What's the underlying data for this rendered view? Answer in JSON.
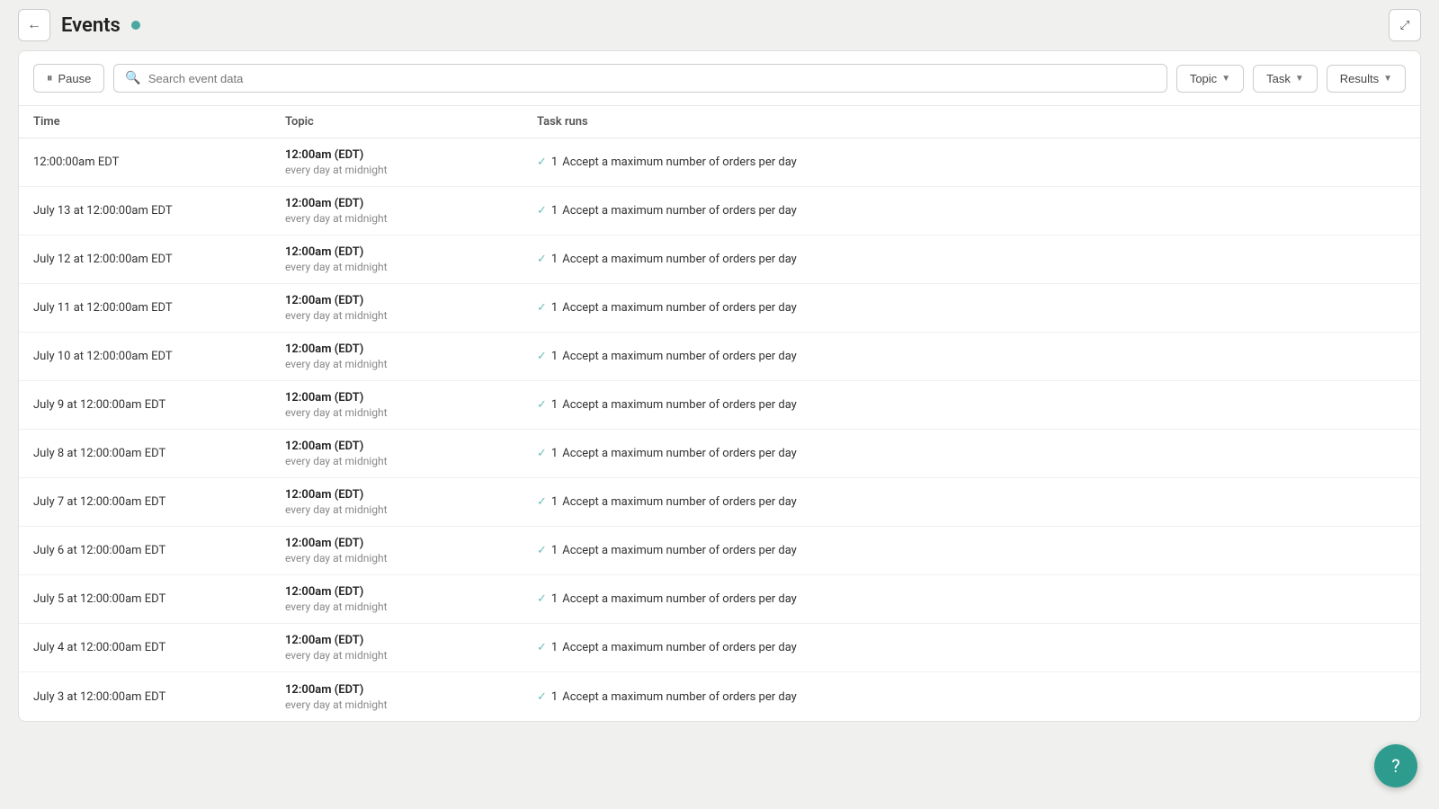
{
  "header": {
    "back_label": "←",
    "title": "Events",
    "expand_label": "⤢"
  },
  "toolbar": {
    "pause_label": "Pause",
    "search_placeholder": "Search event data",
    "topic_label": "Topic",
    "task_label": "Task",
    "results_label": "Results"
  },
  "table": {
    "columns": [
      "Time",
      "Topic",
      "Task runs"
    ],
    "rows": [
      {
        "time": "12:00:00am EDT",
        "topic_time": "12:00am (EDT)",
        "topic_sub": "every day at midnight",
        "task_count": "1",
        "task_label": "Accept a maximum number of orders per day"
      },
      {
        "time": "July 13 at 12:00:00am EDT",
        "topic_time": "12:00am (EDT)",
        "topic_sub": "every day at midnight",
        "task_count": "1",
        "task_label": "Accept a maximum number of orders per day"
      },
      {
        "time": "July 12 at 12:00:00am EDT",
        "topic_time": "12:00am (EDT)",
        "topic_sub": "every day at midnight",
        "task_count": "1",
        "task_label": "Accept a maximum number of orders per day"
      },
      {
        "time": "July 11 at 12:00:00am EDT",
        "topic_time": "12:00am (EDT)",
        "topic_sub": "every day at midnight",
        "task_count": "1",
        "task_label": "Accept a maximum number of orders per day"
      },
      {
        "time": "July 10 at 12:00:00am EDT",
        "topic_time": "12:00am (EDT)",
        "topic_sub": "every day at midnight",
        "task_count": "1",
        "task_label": "Accept a maximum number of orders per day"
      },
      {
        "time": "July 9 at 12:00:00am EDT",
        "topic_time": "12:00am (EDT)",
        "topic_sub": "every day at midnight",
        "task_count": "1",
        "task_label": "Accept a maximum number of orders per day"
      },
      {
        "time": "July 8 at 12:00:00am EDT",
        "topic_time": "12:00am (EDT)",
        "topic_sub": "every day at midnight",
        "task_count": "1",
        "task_label": "Accept a maximum number of orders per day"
      },
      {
        "time": "July 7 at 12:00:00am EDT",
        "topic_time": "12:00am (EDT)",
        "topic_sub": "every day at midnight",
        "task_count": "1",
        "task_label": "Accept a maximum number of orders per day"
      },
      {
        "time": "July 6 at 12:00:00am EDT",
        "topic_time": "12:00am (EDT)",
        "topic_sub": "every day at midnight",
        "task_count": "1",
        "task_label": "Accept a maximum number of orders per day"
      },
      {
        "time": "July 5 at 12:00:00am EDT",
        "topic_time": "12:00am (EDT)",
        "topic_sub": "every day at midnight",
        "task_count": "1",
        "task_label": "Accept a maximum number of orders per day"
      },
      {
        "time": "July 4 at 12:00:00am EDT",
        "topic_time": "12:00am (EDT)",
        "topic_sub": "every day at midnight",
        "task_count": "1",
        "task_label": "Accept a maximum number of orders per day"
      },
      {
        "time": "July 3 at 12:00:00am EDT",
        "topic_time": "12:00am (EDT)",
        "topic_sub": "every day at midnight",
        "task_count": "1",
        "task_label": "Accept a maximum number of orders per day"
      }
    ]
  },
  "support_fab": "?"
}
